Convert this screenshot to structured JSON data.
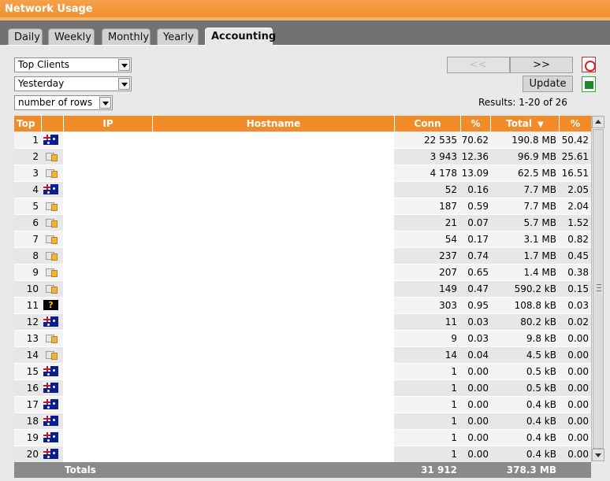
{
  "window": {
    "title": "Network Usage"
  },
  "tabs": [
    {
      "label": "Daily"
    },
    {
      "label": "Weekly"
    },
    {
      "label": "Monthly"
    },
    {
      "label": "Yearly"
    },
    {
      "label": "Accounting",
      "active": true
    }
  ],
  "filters": {
    "report": "Top Clients",
    "period": "Yesterday",
    "rows": "number of rows"
  },
  "nav": {
    "prev": "<<",
    "next": ">>",
    "update": "Update"
  },
  "results": "Results: 1-20 of 26",
  "columns": {
    "top": "Top",
    "ip": "IP",
    "hostname": "Hostname",
    "conn": "Conn",
    "conn_pct": "%",
    "total": "Total",
    "total_pct": "%"
  },
  "sort_indicator": "▼",
  "rows": [
    {
      "top": "1",
      "flag": "australia-flag-icon",
      "conn": "22 535",
      "conn_pct": "70.62",
      "total": "190.8 MB",
      "total_pct": "50.42"
    },
    {
      "top": "2",
      "flag": "local-network-icon",
      "conn": "3 943",
      "conn_pct": "12.36",
      "total": "96.9 MB",
      "total_pct": "25.61"
    },
    {
      "top": "3",
      "flag": "local-network-icon",
      "conn": "4 178",
      "conn_pct": "13.09",
      "total": "62.5 MB",
      "total_pct": "16.51"
    },
    {
      "top": "4",
      "flag": "australia-flag-icon",
      "conn": "52",
      "conn_pct": "0.16",
      "total": "7.7 MB",
      "total_pct": "2.05"
    },
    {
      "top": "5",
      "flag": "local-network-icon",
      "conn": "187",
      "conn_pct": "0.59",
      "total": "7.7 MB",
      "total_pct": "2.04"
    },
    {
      "top": "6",
      "flag": "local-network-icon",
      "conn": "21",
      "conn_pct": "0.07",
      "total": "5.7 MB",
      "total_pct": "1.52"
    },
    {
      "top": "7",
      "flag": "local-network-icon",
      "conn": "54",
      "conn_pct": "0.17",
      "total": "3.1 MB",
      "total_pct": "0.82"
    },
    {
      "top": "8",
      "flag": "local-network-icon",
      "conn": "237",
      "conn_pct": "0.74",
      "total": "1.7 MB",
      "total_pct": "0.45"
    },
    {
      "top": "9",
      "flag": "local-network-icon",
      "conn": "207",
      "conn_pct": "0.65",
      "total": "1.4 MB",
      "total_pct": "0.38"
    },
    {
      "top": "10",
      "flag": "local-network-icon",
      "conn": "149",
      "conn_pct": "0.47",
      "total": "590.2 kB",
      "total_pct": "0.15"
    },
    {
      "top": "11",
      "flag": "unknown-country-icon",
      "conn": "303",
      "conn_pct": "0.95",
      "total": "108.8 kB",
      "total_pct": "0.03"
    },
    {
      "top": "12",
      "flag": "australia-flag-icon",
      "conn": "11",
      "conn_pct": "0.03",
      "total": "80.2 kB",
      "total_pct": "0.02"
    },
    {
      "top": "13",
      "flag": "local-network-icon",
      "conn": "9",
      "conn_pct": "0.03",
      "total": "9.8 kB",
      "total_pct": "0.00"
    },
    {
      "top": "14",
      "flag": "local-network-icon",
      "conn": "14",
      "conn_pct": "0.04",
      "total": "4.5 kB",
      "total_pct": "0.00"
    },
    {
      "top": "15",
      "flag": "australia-flag-icon",
      "conn": "1",
      "conn_pct": "0.00",
      "total": "0.5 kB",
      "total_pct": "0.00"
    },
    {
      "top": "16",
      "flag": "australia-flag-icon",
      "conn": "1",
      "conn_pct": "0.00",
      "total": "0.5 kB",
      "total_pct": "0.00"
    },
    {
      "top": "17",
      "flag": "australia-flag-icon",
      "conn": "1",
      "conn_pct": "0.00",
      "total": "0.4 kB",
      "total_pct": "0.00"
    },
    {
      "top": "18",
      "flag": "australia-flag-icon",
      "conn": "1",
      "conn_pct": "0.00",
      "total": "0.4 kB",
      "total_pct": "0.00"
    },
    {
      "top": "19",
      "flag": "australia-flag-icon",
      "conn": "1",
      "conn_pct": "0.00",
      "total": "0.4 kB",
      "total_pct": "0.00"
    },
    {
      "top": "20",
      "flag": "australia-flag-icon",
      "conn": "1",
      "conn_pct": "0.00",
      "total": "0.4 kB",
      "total_pct": "0.00"
    }
  ],
  "totals": {
    "label": "Totals",
    "conn": "31 912",
    "total": "378.3 MB"
  },
  "colors": {
    "accent": "#f28c28",
    "frame": "#727272",
    "panel": "#e9e9e9",
    "totals_bg": "#8a8a8a"
  }
}
